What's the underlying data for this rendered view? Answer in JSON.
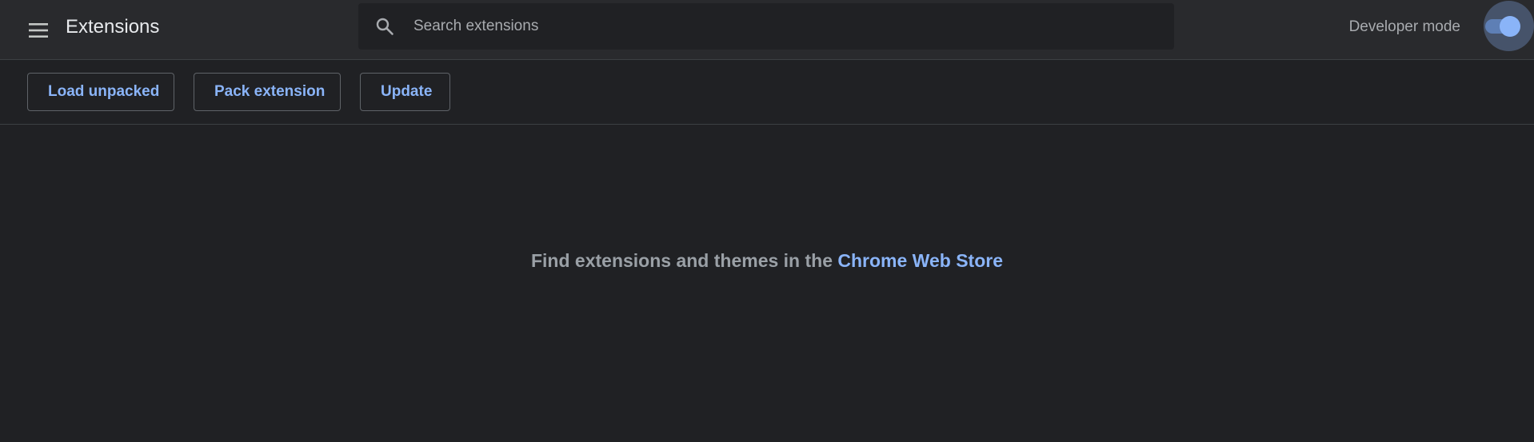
{
  "header": {
    "menu_icon": "hamburger-menu-icon",
    "title": "Extensions",
    "search": {
      "icon": "search-icon",
      "placeholder": "Search extensions",
      "value": ""
    },
    "developer_mode": {
      "label": "Developer mode",
      "enabled": true
    }
  },
  "toolbar": {
    "load_unpacked_label": "Load unpacked",
    "pack_extension_label": "Pack extension",
    "update_label": "Update"
  },
  "main": {
    "message_prefix": "Find extensions and themes in the ",
    "store_link_label": "Chrome Web Store"
  },
  "colors": {
    "background": "#202124",
    "header_background": "#292a2d",
    "accent": "#8ab4f8",
    "muted_text": "#9aa0a6"
  }
}
